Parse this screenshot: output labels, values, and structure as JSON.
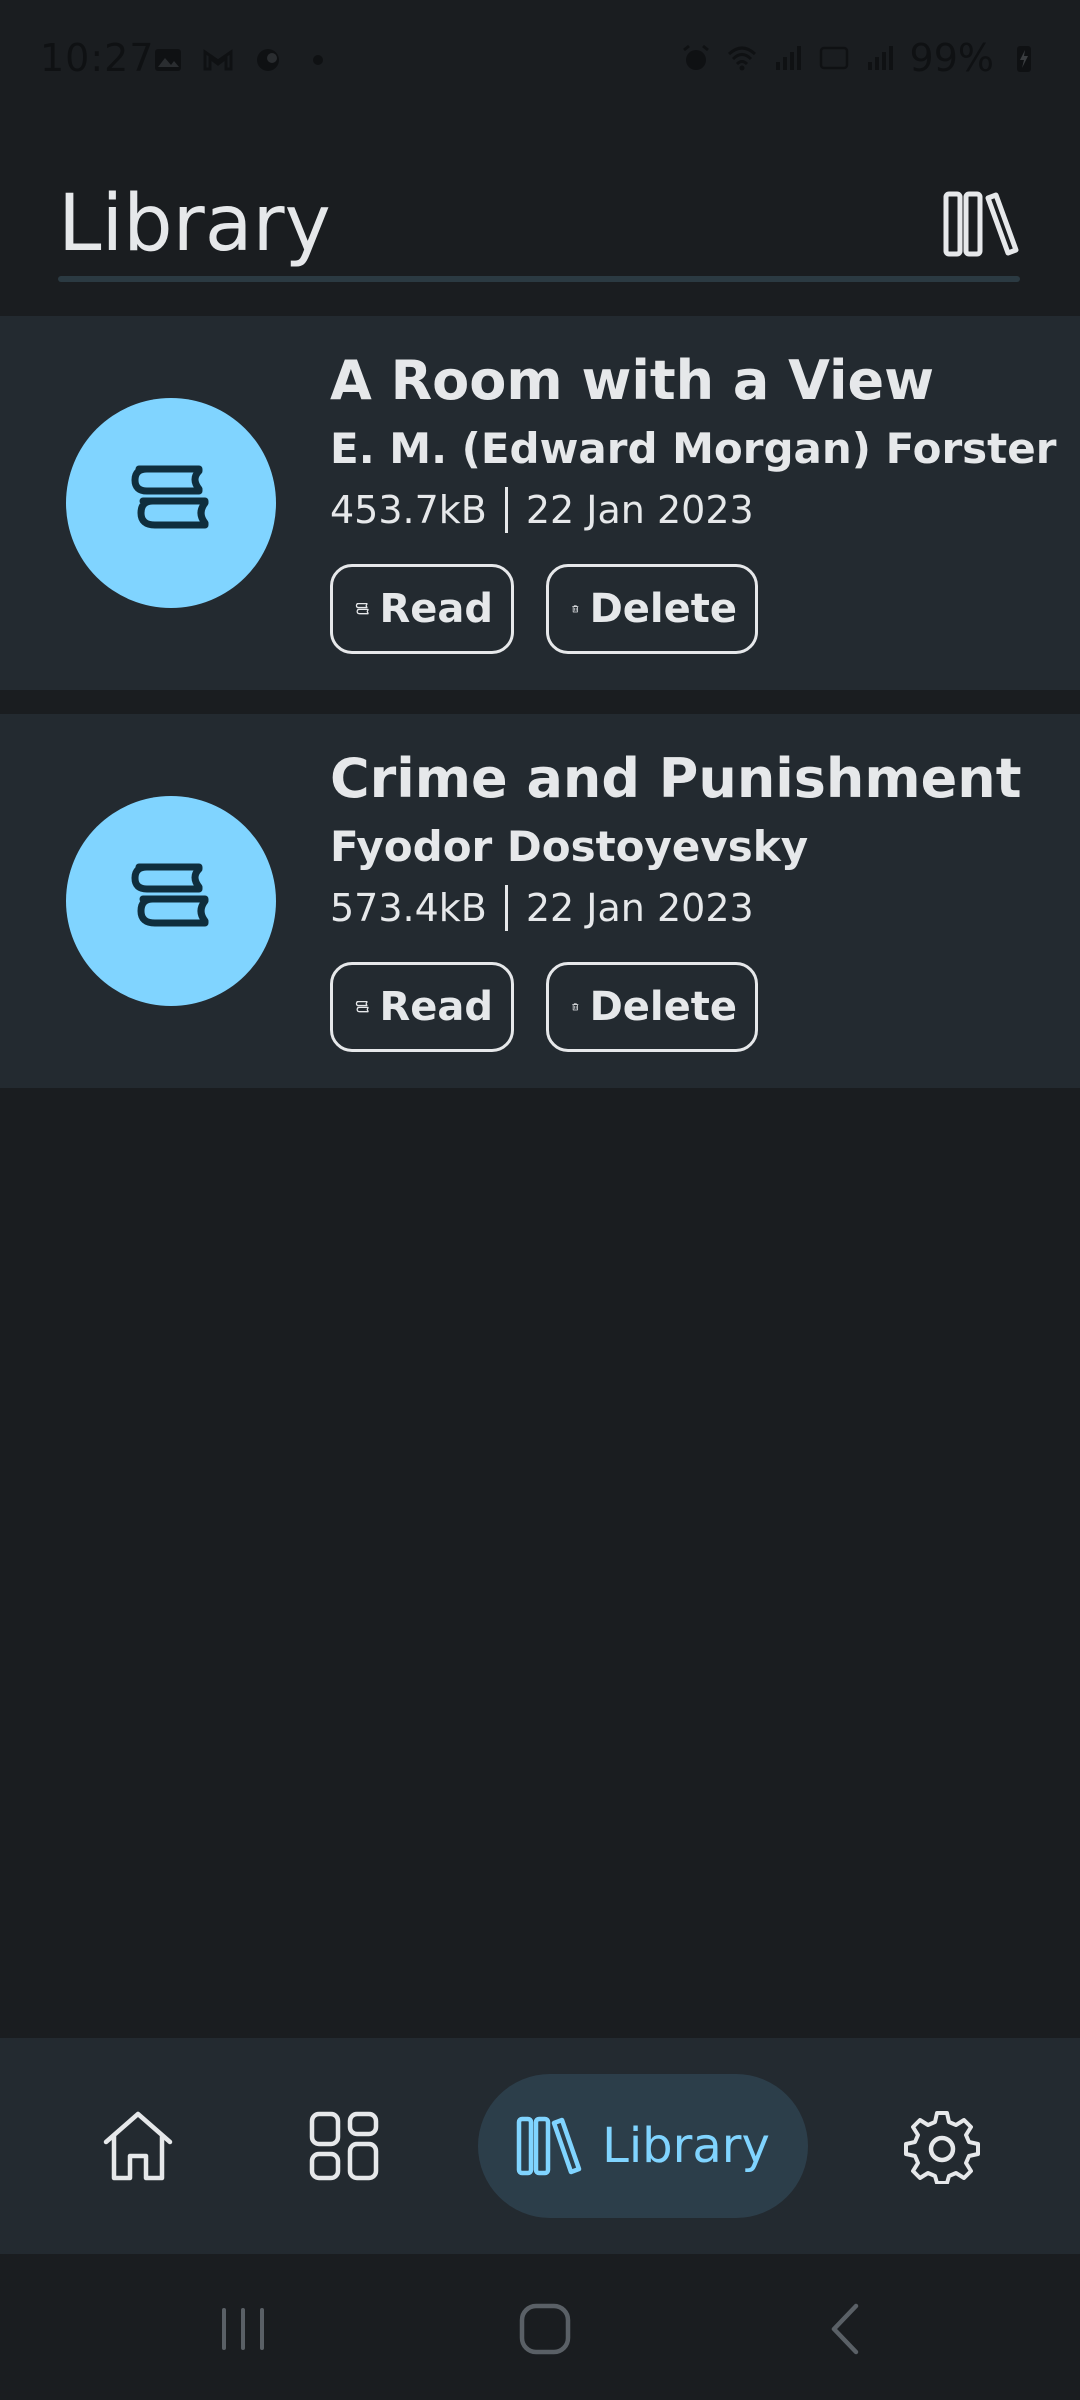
{
  "status_bar": {
    "time": "10:27",
    "battery": "99%",
    "left_icons": [
      "image-icon",
      "gmail-icon",
      "app-icon",
      "dot-icon"
    ],
    "right_icons": [
      "alarm-icon",
      "wifi-icon",
      "signal-icon",
      "volte-icon",
      "signal-icon",
      "battery-charging-icon"
    ]
  },
  "header": {
    "title": "Library",
    "icon": "library-icon"
  },
  "books": [
    {
      "title": "A Room with a View",
      "author": "E. M. (Edward Morgan) Forster",
      "size": "453.7kB",
      "date": "22 Jan 2023",
      "read_label": "Read",
      "delete_label": "Delete"
    },
    {
      "title": "Crime and Punishment",
      "author": "Fyodor Dostoyevsky",
      "size": "573.4kB",
      "date": "22 Jan 2023",
      "read_label": "Read",
      "delete_label": "Delete"
    }
  ],
  "bottom_nav": {
    "items": [
      {
        "icon": "home-icon"
      },
      {
        "icon": "grid-icon"
      },
      {
        "icon": "library-icon",
        "label": "Library",
        "active": true
      },
      {
        "icon": "settings-icon"
      }
    ]
  },
  "colors": {
    "background": "#1a1d20",
    "card": "#232a30",
    "accent": "#80d4ff",
    "text": "#e6e8ea",
    "active_pill": "#2c3e4a"
  }
}
